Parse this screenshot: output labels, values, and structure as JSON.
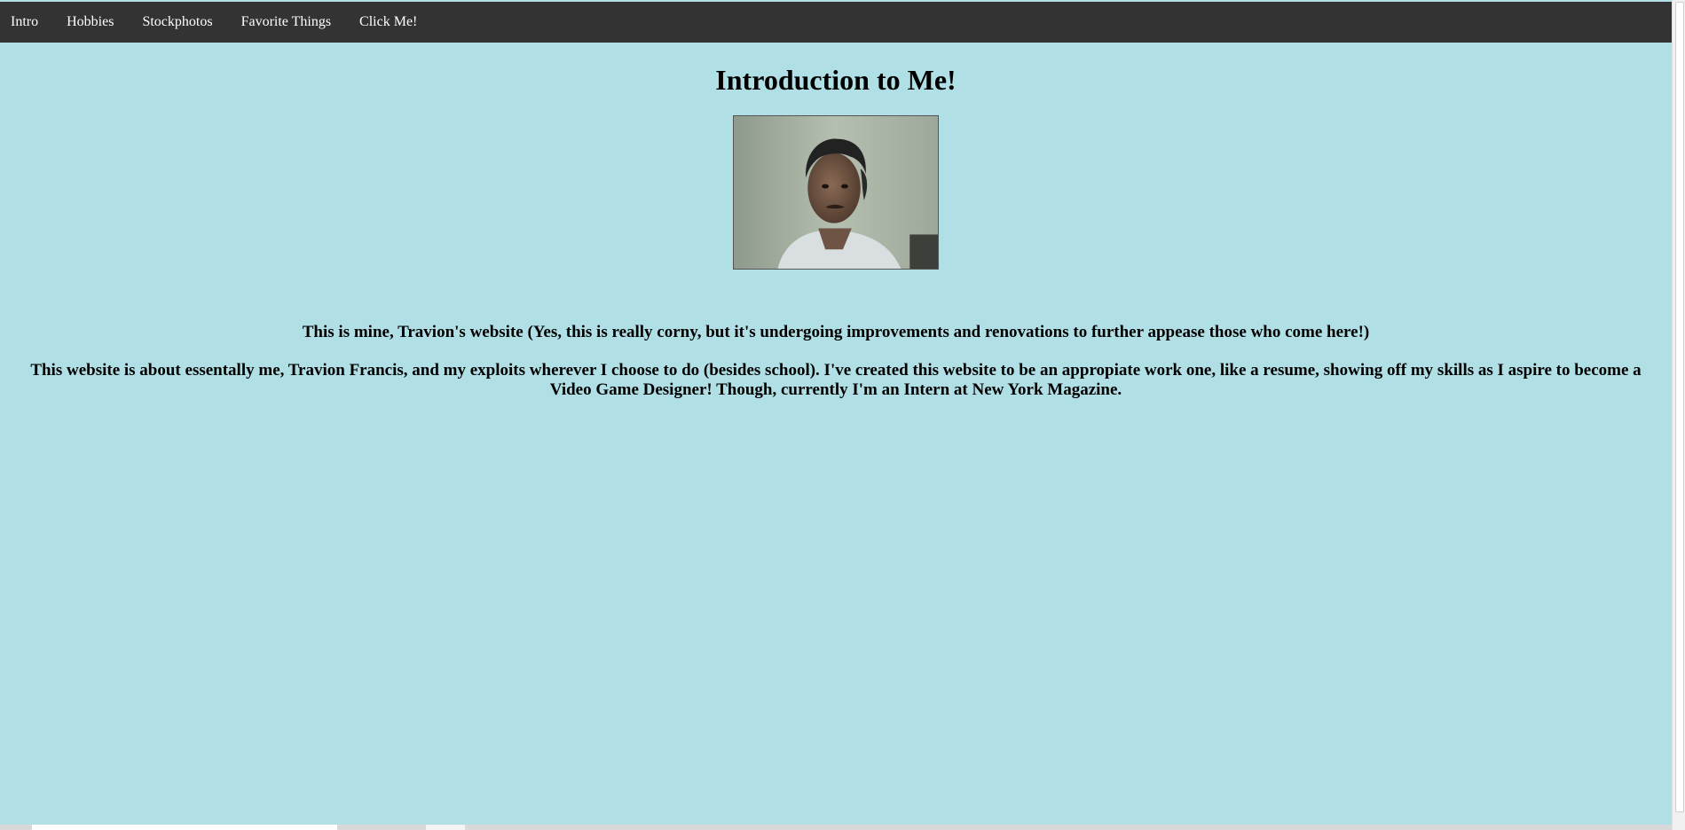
{
  "nav": {
    "items": [
      {
        "label": "Intro"
      },
      {
        "label": "Hobbies"
      },
      {
        "label": "Stockphotos"
      },
      {
        "label": "Favorite Things"
      },
      {
        "label": "Click Me!"
      }
    ]
  },
  "main": {
    "title": "Introduction to Me!",
    "paragraphs": [
      "This is mine, Travion's website (Yes, this is really corny, but it's undergoing improvements and renovations to further appease those who come here!)",
      "This website is about essentally me, Travion Francis, and my exploits wherever I choose to do (besides school). I've created this website to be an appropiate work one, like a resume, showing off my skills as I aspire to become a Video Game Designer! Though, currently I'm an Intern at New York Magazine."
    ]
  },
  "colors": {
    "page_background": "#b0dfe5",
    "navbar_background": "#333333",
    "nav_text": "#ffffff",
    "body_text": "#000000"
  }
}
